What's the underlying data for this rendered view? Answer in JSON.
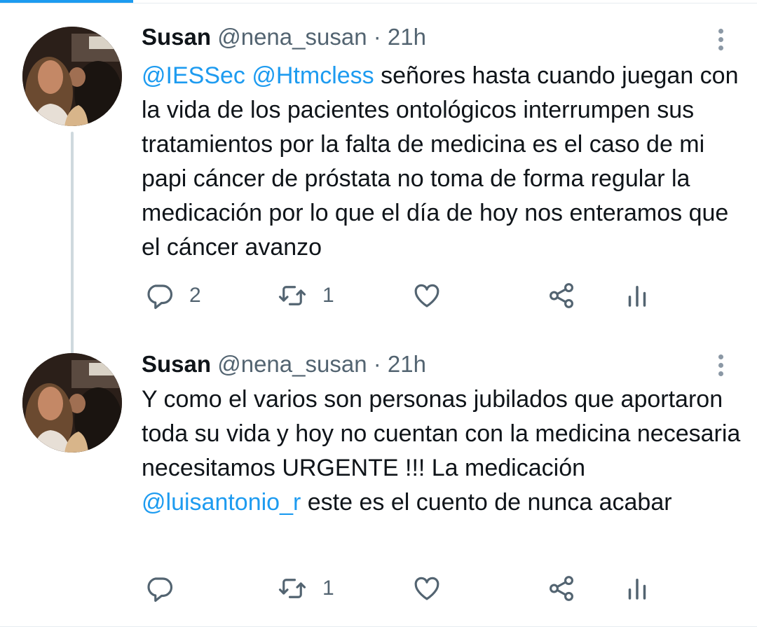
{
  "tweets": [
    {
      "author": {
        "name": "Susan",
        "handle": "@nena_susan",
        "separator": "·",
        "time": "21h"
      },
      "text_parts": [
        {
          "type": "mention",
          "value": "@IESSec"
        },
        {
          "type": "text",
          "value": " "
        },
        {
          "type": "mention",
          "value": "@Htmcless"
        },
        {
          "type": "text",
          "value": " señores hasta cuando juegan con la vida de los pacientes ontológicos interrumpen sus tratamientos por la falta de medicina es el caso de mi papi cáncer de próstata no toma de forma regular la medicación por lo que el día de hoy nos enteramos que el cáncer avanzo"
        }
      ],
      "actions": {
        "replies": "2",
        "retweets": "1",
        "likes": ""
      },
      "has_thread_line": true
    },
    {
      "author": {
        "name": "Susan",
        "handle": "@nena_susan",
        "separator": "·",
        "time": "21h"
      },
      "text_parts": [
        {
          "type": "text",
          "value": "Y como el varios son personas jubilados que aportaron toda su vida y hoy no cuentan con la medicina necesaria necesitamos URGENTE !!! La medicación "
        },
        {
          "type": "mention",
          "value": "@luisantonio_r"
        },
        {
          "type": "text",
          "value": " este es el cuento de nunca acabar"
        }
      ],
      "actions": {
        "replies": "",
        "retweets": "1",
        "likes": ""
      },
      "has_thread_line": false
    }
  ],
  "icons": {
    "reply": "reply-icon",
    "retweet": "retweet-icon",
    "like": "heart-icon",
    "share": "share-icon",
    "analytics": "analytics-icon",
    "more": "more-vertical-icon"
  },
  "colors": {
    "accent": "#1d9bf0",
    "secondary_text": "#536471",
    "icon": "#536471",
    "thread_line": "#cfd9de"
  }
}
